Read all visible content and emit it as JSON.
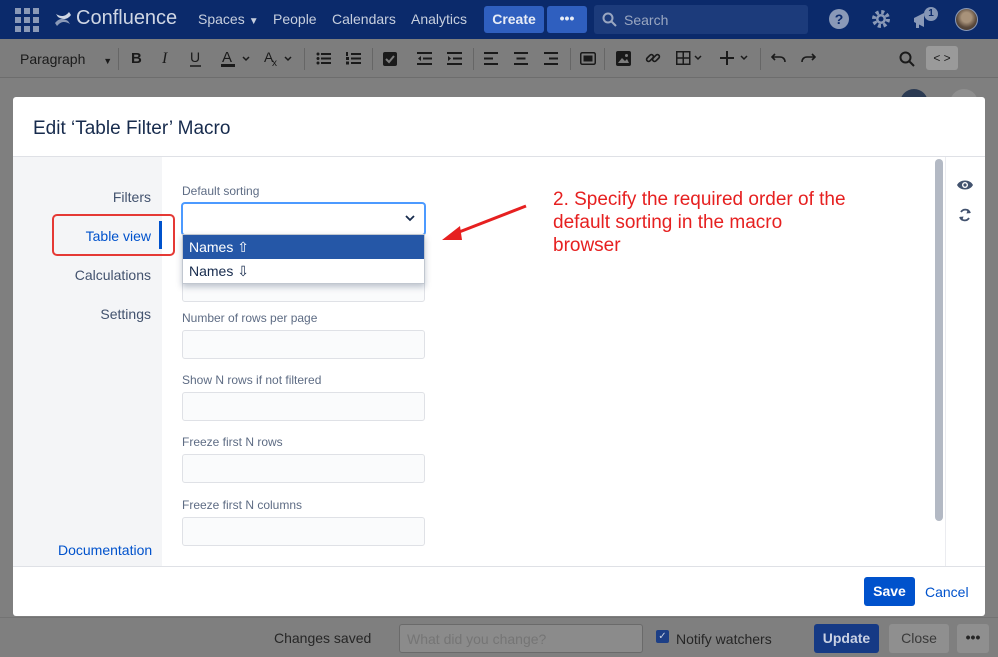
{
  "topnav": {
    "product": "Confluence",
    "items": [
      {
        "label": "Spaces",
        "has_dropdown": true
      },
      {
        "label": "People"
      },
      {
        "label": "Calendars"
      },
      {
        "label": "Analytics"
      }
    ],
    "create_label": "Create",
    "more_label": "•••",
    "search_placeholder": "Search",
    "notification_count": "1"
  },
  "toolbar": {
    "paragraph_label": "Paragraph",
    "code_label": "< >"
  },
  "modal": {
    "title": "Edit ‘Table Filter’ Macro",
    "side_items": [
      {
        "label": "Filters"
      },
      {
        "label": "Table view",
        "active": true
      },
      {
        "label": "Calculations"
      },
      {
        "label": "Settings"
      }
    ],
    "documentation_label": "Documentation",
    "fields": {
      "default_sorting_label": "Default sorting",
      "default_sorting_value": "",
      "rows_per_page_label": "Number of rows per page",
      "show_n_rows_label": "Show N rows if not filtered",
      "freeze_rows_label": "Freeze first N rows",
      "freeze_columns_label": "Freeze first N columns"
    },
    "dropdown_options": [
      {
        "label": "Names ⇧",
        "selected": true
      },
      {
        "label": "Names ⇩",
        "selected": false
      }
    ],
    "annotation": "2. Specify the required order of the default sorting in the macro browser",
    "save_label": "Save",
    "cancel_label": "Cancel"
  },
  "bottombar": {
    "status": "Changes saved",
    "comment_placeholder": "What did you change?",
    "notify_label": "Notify watchers",
    "notify_checked": true,
    "update_label": "Update",
    "close_label": "Close",
    "more_label": "•••"
  },
  "colors": {
    "nav_bg": "#0b2a6b",
    "primary": "#0052CC",
    "annotation_red": "#e62020",
    "highlight_border": "#e53935",
    "selected_option": "#2557a7"
  }
}
